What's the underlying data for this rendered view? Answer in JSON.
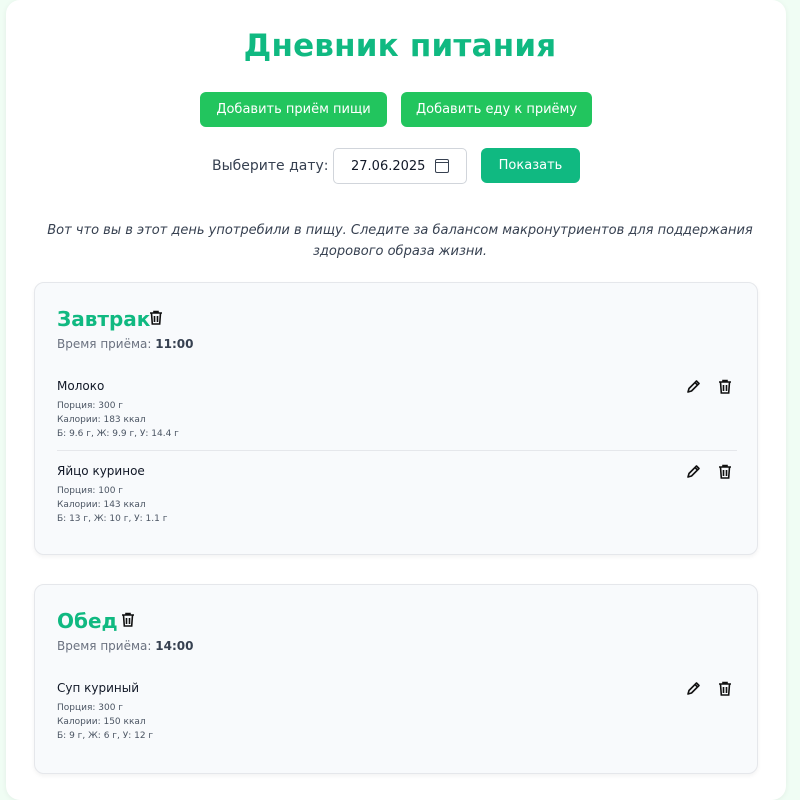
{
  "header": {
    "title": "Дневник питания",
    "add_meal_label": "Добавить приём пищи",
    "add_food_label": "Добавить еду к приёму",
    "date_label": "Выберите дату:",
    "date_value": "27.06.2025",
    "show_label": "Показать",
    "intro": "Вот что вы в этот день употребили в пищу. Следите за балансом макронутриентов для поддержания здорового образа жизни."
  },
  "colors": {
    "accent": "#10b981",
    "button_green": "#22c55e",
    "page_bg": "#f0fdf4"
  },
  "icons": {
    "delete": "trash-icon",
    "edit": "pencil-icon",
    "date": "calendar-icon"
  },
  "meals": [
    {
      "name": "Завтрак",
      "time_label": "Время приёма:",
      "time": "11:00",
      "foods": [
        {
          "name": "Молоко",
          "portion": "Порция: 300 г",
          "calories": "Калории: 183 ккал",
          "macros": "Б: 9.6 г, Ж: 9.9 г, У: 14.4 г"
        },
        {
          "name": "Яйцо куриное",
          "portion": "Порция: 100 г",
          "calories": "Калории: 143 ккал",
          "macros": "Б: 13 г, Ж: 10 г, У: 1.1 г"
        }
      ]
    },
    {
      "name": "Обед",
      "time_label": "Время приёма:",
      "time": "14:00",
      "foods": [
        {
          "name": "Суп куриный",
          "portion": "Порция: 300 г",
          "calories": "Калории: 150 ккал",
          "macros": "Б: 9 г, Ж: 6 г, У: 12 г"
        }
      ]
    }
  ]
}
